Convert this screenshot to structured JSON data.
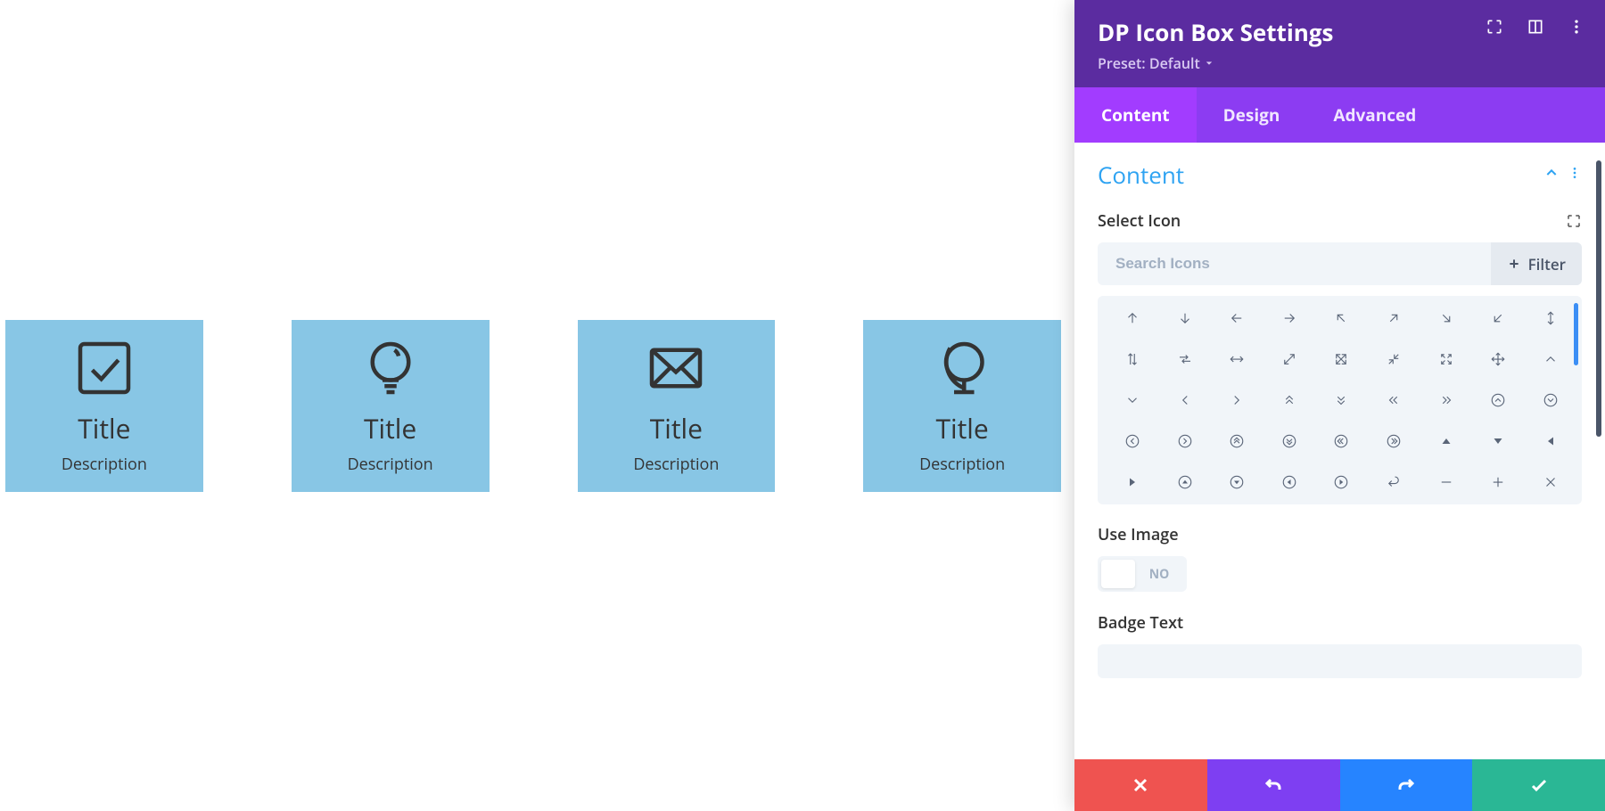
{
  "preview": {
    "cards": [
      {
        "icon": "check-box",
        "title": "Title",
        "desc": "Description"
      },
      {
        "icon": "lightbulb",
        "title": "Title",
        "desc": "Description"
      },
      {
        "icon": "envelope",
        "title": "Title",
        "desc": "Description"
      },
      {
        "icon": "globe",
        "title": "Title",
        "desc": "Description"
      }
    ]
  },
  "panel": {
    "title": "DP Icon Box Settings",
    "preset_label": "Preset: Default",
    "tabs": {
      "content": "Content",
      "design": "Design",
      "advanced": "Advanced",
      "active": "content"
    },
    "section_title": "Content",
    "select_icon_label": "Select Icon",
    "search_placeholder": "Search Icons",
    "filter_label": "Filter",
    "use_image_label": "Use Image",
    "use_image_value": "NO",
    "badge_text_label": "Badge Text",
    "icon_grid": [
      "arrow-up",
      "arrow-down",
      "arrow-left",
      "arrow-right",
      "arrow-up-left",
      "arrow-up-right",
      "arrow-down-right",
      "arrow-down-left",
      "arrows-vert",
      "arrows-vert-alt",
      "swap-horiz",
      "arrows-horiz",
      "expand-diag",
      "expand-full",
      "compress-diag",
      "expand-out",
      "move",
      "chevron-up",
      "chevron-down",
      "chevron-left",
      "chevron-right",
      "chevrons-up",
      "chevrons-down",
      "chevrons-left",
      "chevrons-right",
      "circle-chevron-up",
      "circle-chevron-down",
      "circle-chevron-left",
      "circle-chevron-right",
      "circle-chevrons-up",
      "circle-chevrons-down",
      "circle-chevrons-left",
      "circle-chevrons-right",
      "triangle-up",
      "triangle-down",
      "triangle-left",
      "triangle-right",
      "circle-triangle-up",
      "circle-triangle-down",
      "circle-triangle-left",
      "circle-triangle-right",
      "undo",
      "minus",
      "plus",
      "close"
    ]
  },
  "colors": {
    "card_bg": "#88c6e5",
    "header_bg": "#5b2ca0",
    "tabs_bg": "#8c3cf2",
    "tab_active_bg": "#a23cff",
    "accent_link": "#2ea3f2",
    "footer_cancel": "#ef5350",
    "footer_undo": "#7e3ff2",
    "footer_redo": "#2684ff",
    "footer_save": "#2ab795"
  }
}
